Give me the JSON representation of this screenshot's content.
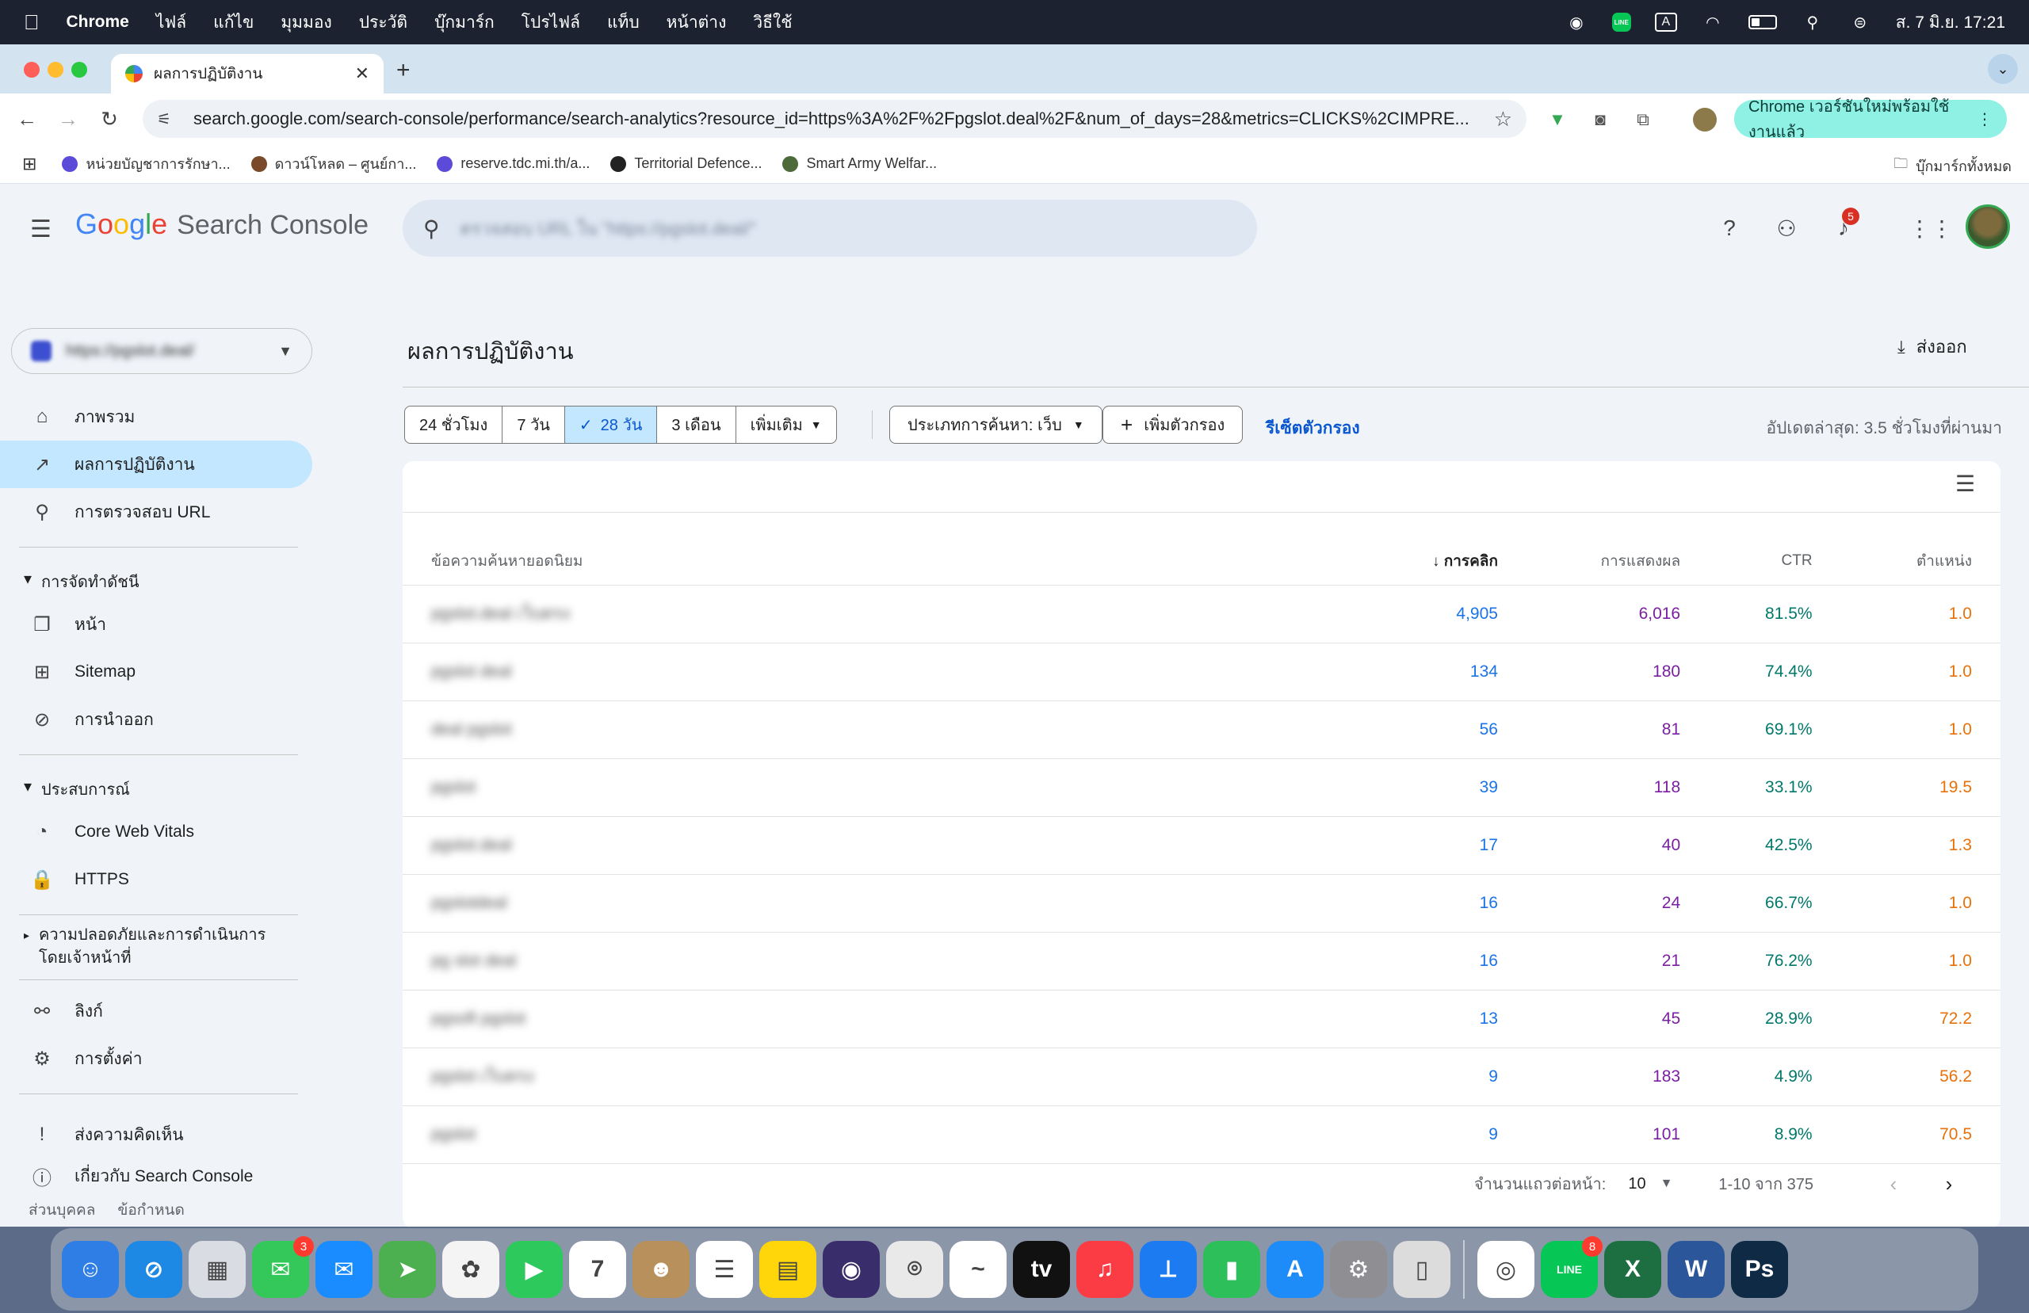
{
  "menubar": {
    "app_name": "Chrome",
    "items": [
      "ไฟล์",
      "แก้ไข",
      "มุมมอง",
      "ประวัติ",
      "บุ๊กมาร์ก",
      "โปรไฟล์",
      "แท็บ",
      "หน้าต่าง",
      "วิธีใช้"
    ],
    "clock": "ส. 7 มิ.ย.  17:21",
    "input_indicator": "A"
  },
  "browser": {
    "tab_title": "ผลการปฏิบัติงาน",
    "url": "search.google.com/search-console/performance/search-analytics?resource_id=https%3A%2F%2Fpgslot.deal%2F&num_of_days=28&metrics=CLICKS%2CIMPRE...",
    "update_label": "Chrome เวอร์ชันใหม่พร้อมใช้งานแล้ว",
    "bookmarks": [
      {
        "label": "หน่วยบัญชาการรักษา...",
        "color": "#5c4bd8"
      },
      {
        "label": "ดาวน์โหลด – ศูนย์กา...",
        "color": "#7a4a2a"
      },
      {
        "label": "reserve.tdc.mi.th/a...",
        "color": "#5c4bd8"
      },
      {
        "label": "Territorial Defence...",
        "color": "#222222"
      },
      {
        "label": "Smart Army Welfar...",
        "color": "#4c6a3a"
      }
    ],
    "all_bookmarks": "บุ๊กมาร์กทั้งหมด"
  },
  "app": {
    "logo_google": [
      "G",
      "o",
      "o",
      "g",
      "l",
      "e"
    ],
    "logo_product": "Search Console",
    "search_placeholder": "ตรวจสอบ URL ใน \"https://pgslot.deal/\"",
    "notification_count": "5",
    "property_name": "https://pgslot.deal/"
  },
  "sidebar": {
    "items_top": [
      {
        "label": "ภาพรวม",
        "icon": "home-icon",
        "glyph": "⌂"
      },
      {
        "label": "ผลการปฏิบัติงาน",
        "icon": "trending-up-icon",
        "glyph": "↗"
      },
      {
        "label": "การตรวจสอบ URL",
        "icon": "search-icon",
        "glyph": "⚲"
      }
    ],
    "section_indexing": "การจัดทำดัชนี",
    "items_indexing": [
      {
        "label": "หน้า",
        "icon": "pages-icon",
        "glyph": "❐"
      },
      {
        "label": "Sitemap",
        "icon": "sitemap-icon",
        "glyph": "⊞"
      },
      {
        "label": "การนำออก",
        "icon": "visibility-off-icon",
        "glyph": "⊘"
      }
    ],
    "section_experience": "ประสบการณ์",
    "items_experience": [
      {
        "label": "Core Web Vitals",
        "icon": "speed-icon",
        "glyph": "◔"
      },
      {
        "label": "HTTPS",
        "icon": "lock-icon",
        "glyph": "🔒"
      }
    ],
    "section_security": "ความปลอดภัยและการดำเนินการโดยเจ้าหน้าที่",
    "items_bottom": [
      {
        "label": "ลิงก์",
        "icon": "links-icon",
        "glyph": "⚯"
      },
      {
        "label": "การตั้งค่า",
        "icon": "settings-icon",
        "glyph": "⚙"
      }
    ],
    "items_feedback": [
      {
        "label": "ส่งความคิดเห็น",
        "icon": "feedback-icon",
        "glyph": "!"
      },
      {
        "label": "เกี่ยวกับ Search Console",
        "icon": "info-icon",
        "glyph": "ⓘ"
      }
    ],
    "footer_privacy": "ส่วนบุคคล",
    "footer_terms": "ข้อกำหนด"
  },
  "main": {
    "title": "ผลการปฏิบัติงาน",
    "export_label": "ส่งออก",
    "date_ranges": [
      {
        "label": "24 ชั่วโมง",
        "selected": false
      },
      {
        "label": "7 วัน",
        "selected": false
      },
      {
        "label": "28 วัน",
        "selected": true
      },
      {
        "label": "3 เดือน",
        "selected": false
      },
      {
        "label": "เพิ่มเติม",
        "selected": false
      }
    ],
    "search_type": "ประเภทการค้นหา: เว็บ",
    "add_filter": "เพิ่มตัวกรอง",
    "reset_filter": "รีเซ็ตตัวกรอง",
    "last_update": "อัปเดตล่าสุด: 3.5 ชั่วโมงที่ผ่านมา"
  },
  "table": {
    "columns": {
      "query": "ข้อความค้นหายอดนิยม",
      "clicks": "การคลิก",
      "impressions": "การแสดงผล",
      "ctr": "CTR",
      "position": "ตำแหน่ง"
    },
    "rows": [
      {
        "query": "pgslot.deal เว็บตรง",
        "clicks": "4,905",
        "impressions": "6,016",
        "ctr": "81.5%",
        "position": "1.0"
      },
      {
        "query": "pgslot deal",
        "clicks": "134",
        "impressions": "180",
        "ctr": "74.4%",
        "position": "1.0"
      },
      {
        "query": "deal pgslot",
        "clicks": "56",
        "impressions": "81",
        "ctr": "69.1%",
        "position": "1.0"
      },
      {
        "query": "pgslot",
        "clicks": "39",
        "impressions": "118",
        "ctr": "33.1%",
        "position": "19.5"
      },
      {
        "query": "pgslot.deal",
        "clicks": "17",
        "impressions": "40",
        "ctr": "42.5%",
        "position": "1.3"
      },
      {
        "query": "pgslotdeal",
        "clicks": "16",
        "impressions": "24",
        "ctr": "66.7%",
        "position": "1.0"
      },
      {
        "query": "pg slot deal",
        "clicks": "16",
        "impressions": "21",
        "ctr": "76.2%",
        "position": "1.0"
      },
      {
        "query": "pgsoft pgslot",
        "clicks": "13",
        "impressions": "45",
        "ctr": "28.9%",
        "position": "72.2"
      },
      {
        "query": "pgslot เว็บตรง",
        "clicks": "9",
        "impressions": "183",
        "ctr": "4.9%",
        "position": "56.2"
      },
      {
        "query": "pgslot",
        "clicks": "9",
        "impressions": "101",
        "ctr": "8.9%",
        "position": "70.5"
      }
    ],
    "rows_per_page_label": "จำนวนแถวต่อหน้า:",
    "rows_per_page": "10",
    "range": "1-10 จาก 375"
  },
  "dock": {
    "apps": [
      {
        "name": "finder",
        "color": "#2f7ee6",
        "glyph": "☺",
        "badge": ""
      },
      {
        "name": "safari",
        "color": "#1e88e5",
        "glyph": "⊘",
        "badge": ""
      },
      {
        "name": "launchpad",
        "color": "#d9dde3",
        "glyph": "▦",
        "badge": ""
      },
      {
        "name": "messages",
        "color": "#34c759",
        "glyph": "✉",
        "badge": "3"
      },
      {
        "name": "mail",
        "color": "#1a8cff",
        "glyph": "✉",
        "badge": ""
      },
      {
        "name": "maps",
        "color": "#4caf50",
        "glyph": "➤",
        "badge": ""
      },
      {
        "name": "photos",
        "color": "#f4f4f4",
        "glyph": "✿",
        "badge": ""
      },
      {
        "name": "facetime",
        "color": "#2ec95c",
        "glyph": "▶",
        "badge": ""
      },
      {
        "name": "calendar",
        "color": "#ffffff",
        "glyph": "7",
        "badge": ""
      },
      {
        "name": "contacts",
        "color": "#b8905c",
        "glyph": "☻",
        "badge": ""
      },
      {
        "name": "reminders",
        "color": "#ffffff",
        "glyph": "☰",
        "badge": ""
      },
      {
        "name": "notes",
        "color": "#ffd60a",
        "glyph": "▤",
        "badge": ""
      },
      {
        "name": "siri",
        "color": "#3a2d6b",
        "glyph": "◉",
        "badge": ""
      },
      {
        "name": "screenshot",
        "color": "#e9e9e9",
        "glyph": "⌾",
        "badge": ""
      },
      {
        "name": "freeform",
        "color": "#ffffff",
        "glyph": "~",
        "badge": ""
      },
      {
        "name": "apple-tv",
        "color": "#111111",
        "glyph": "tv",
        "badge": ""
      },
      {
        "name": "music",
        "color": "#fc3c44",
        "glyph": "♫",
        "badge": ""
      },
      {
        "name": "keynote",
        "color": "#1d7bf2",
        "glyph": "⟂",
        "badge": ""
      },
      {
        "name": "numbers",
        "color": "#2dbf5a",
        "glyph": "▮",
        "badge": ""
      },
      {
        "name": "app-store",
        "color": "#1d8cf8",
        "glyph": "A",
        "badge": ""
      },
      {
        "name": "system-settings",
        "color": "#8e8e93",
        "glyph": "⚙",
        "badge": ""
      },
      {
        "name": "iphone-mirroring",
        "color": "#dcdcdc",
        "glyph": "▯",
        "badge": ""
      }
    ],
    "apps_right": [
      {
        "name": "chrome",
        "color": "#ffffff",
        "glyph": "◎",
        "badge": ""
      },
      {
        "name": "line",
        "color": "#06c755",
        "glyph": "LINE",
        "badge": "8"
      },
      {
        "name": "excel",
        "color": "#1d6f42",
        "glyph": "X",
        "badge": ""
      },
      {
        "name": "word",
        "color": "#2b579a",
        "glyph": "W",
        "badge": ""
      },
      {
        "name": "photoshop",
        "color": "#0f2a44",
        "glyph": "Ps",
        "badge": ""
      }
    ]
  }
}
